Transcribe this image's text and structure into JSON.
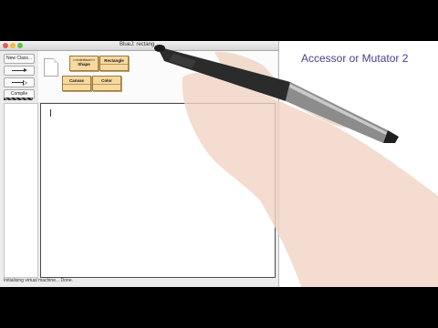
{
  "window": {
    "title": "BlueJ: rectang"
  },
  "toolbar": {
    "new_class_label": "New Class...",
    "uses_arrow_icon": "solid-arrow-icon",
    "inherits_arrow_icon": "hollow-arrow-icon",
    "compile_label": "Compile"
  },
  "diagram": {
    "classes": [
      {
        "stereotype": "<<interface>>",
        "name": "Shape"
      },
      {
        "stereotype": "",
        "name": "Rectangle"
      },
      {
        "stereotype": "",
        "name": "Canvas"
      },
      {
        "stereotype": "",
        "name": "Color"
      }
    ]
  },
  "status": {
    "text": "Initialising virtual machine... Done."
  },
  "lesson": {
    "title": "Accessor or Mutator 2"
  },
  "colors": {
    "class_fill": "#f7d9a0",
    "lesson_title": "#4a3f8c"
  }
}
